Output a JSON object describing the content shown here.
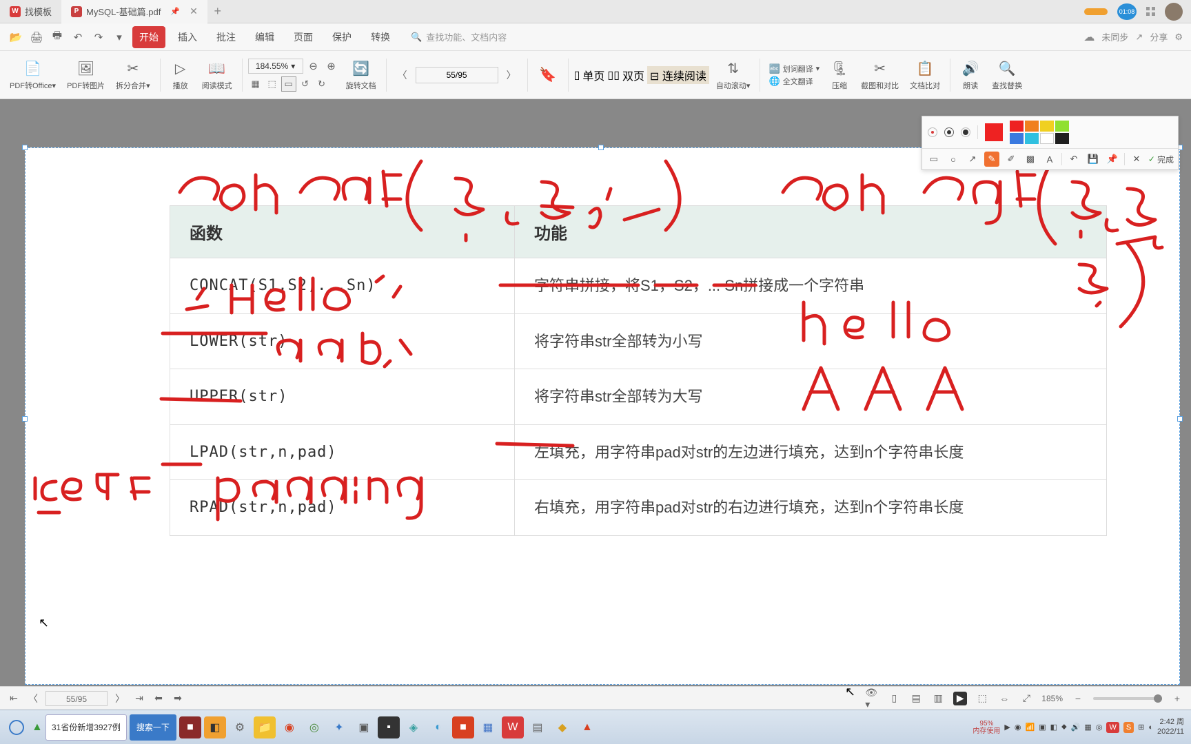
{
  "tabs": {
    "tab1": "找模板",
    "tab2": "MySQL-基础篇.pdf"
  },
  "titlebar": {
    "clock": "01:08"
  },
  "menubar": {
    "start": "开始",
    "insert": "插入",
    "annot": "批注",
    "edit": "编辑",
    "page": "页面",
    "protect": "保护",
    "convert": "转换",
    "search_ph": "查找功能、文档内容",
    "sync": "未同步",
    "share": "分享"
  },
  "ribbon": {
    "pdf2office": "PDF转Office",
    "pdf2img": "PDF转图片",
    "split": "拆分合并",
    "play": "播放",
    "readmode": "阅读模式",
    "zoom": "184.55%",
    "page": "55/95",
    "rotate": "旋转文档",
    "single": "单页",
    "double": "双页",
    "continuous": "连续阅读",
    "autoscroll": "自动滚动",
    "wordtrans": "划词翻译",
    "fulltrans": "全文翻译",
    "compress": "压缩",
    "crop": "截图和对比",
    "compare": "文档比对",
    "read": "朗读",
    "findreplace": "查找替换"
  },
  "anno": {
    "done": "完成"
  },
  "colors": {
    "red": "#ee2222",
    "orange": "#f08020",
    "yellow": "#f0d020",
    "lime": "#90e030",
    "blue": "#3a7ae0",
    "cyan": "#30c0e0",
    "white": "#ffffff",
    "black": "#202020"
  },
  "table": {
    "h1": "函数",
    "h2": "功能",
    "r1c1": "CONCAT(S1,S2,...Sn)",
    "r1c2": "字符串拼接，将S1，S2，... Sn拼接成一个字符串",
    "r2c1": "LOWER(str)",
    "r2c2": "将字符串str全部转为小写",
    "r3c1": "UPPER(str)",
    "r3c2": "将字符串str全部转为大写",
    "r4c1": "LPAD(str,n,pad)",
    "r4c2": "左填充，用字符串pad对str的左边进行填充，达到n个字符串长度",
    "r5c1": "RPAD(str,n,pad)",
    "r5c2": "右填充，用字符串pad对str的右边进行填充，达到n个字符串长度"
  },
  "statusbar": {
    "page": "55/95",
    "zoom": "185%"
  },
  "taskbar": {
    "news": "31省份新增3927例",
    "search": "搜索一下",
    "mem_pct": "95%",
    "mem_lbl": "内存使用",
    "time": "2:42 周",
    "date": "2022/11"
  }
}
